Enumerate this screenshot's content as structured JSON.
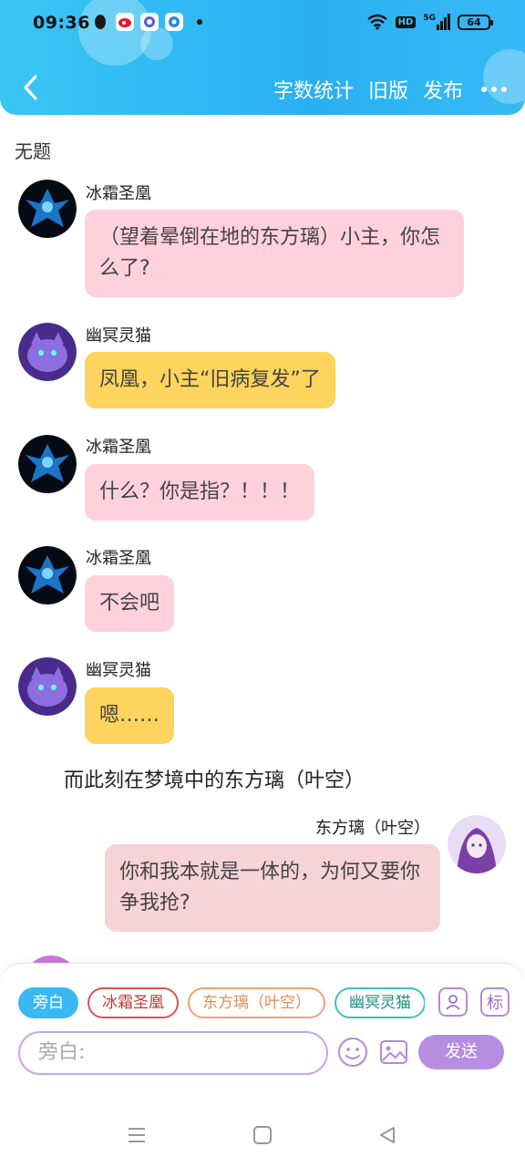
{
  "status_bar": {
    "time": "09:36",
    "network": "5G",
    "hd_label": "HD",
    "battery": "64"
  },
  "header": {
    "back_icon": "chevron-left-icon",
    "word_count_label": "字数统计",
    "old_version_label": "旧版",
    "publish_label": "发布",
    "more_icon": "more-dots-icon",
    "accent_color": "#2ab0f2"
  },
  "document": {
    "title": "无题"
  },
  "messages": [
    {
      "speaker": "冰霜圣凰",
      "text": "（望着晕倒在地的东方璃）小主，你怎么了?",
      "bubble_color": "#ffd1dc"
    },
    {
      "speaker": "幽冥灵猫",
      "text": "凤凰，小主“旧病复发”了",
      "bubble_color": "#fcd45e"
    },
    {
      "speaker": "冰霜圣凰",
      "text": "什么？你是指？！！！",
      "bubble_color": "#ffd1dc"
    },
    {
      "speaker": "冰霜圣凰",
      "text": "不会吧",
      "bubble_color": "#ffd1dc"
    },
    {
      "speaker": "幽冥灵猫",
      "text": "嗯……",
      "bubble_color": "#fcd45e"
    }
  ],
  "narration": "而此刻在梦境中的东方璃（叶空）",
  "right_message": {
    "speaker": "东方璃（叶空）",
    "text": "你和我本就是一体的，为何又要你争我抢?",
    "bubble_color": "#f5d3d8"
  },
  "role_chips": [
    {
      "label": "旁白",
      "active": true
    },
    {
      "label": "冰霜圣凰",
      "active": false
    },
    {
      "label": "东方璃（叶空）",
      "active": false
    },
    {
      "label": "幽冥灵猫",
      "active": false
    }
  ],
  "toolbar_icons": {
    "role_icon": "person-icon",
    "tag_label": "标"
  },
  "composer": {
    "placeholder": "旁白:",
    "emoji_icon": "smiley-icon",
    "image_icon": "image-icon",
    "send_label": "发送"
  },
  "navbar": {
    "menu_icon": "menu-icon",
    "home_icon": "home-icon",
    "back_icon": "back-triangle-icon"
  }
}
